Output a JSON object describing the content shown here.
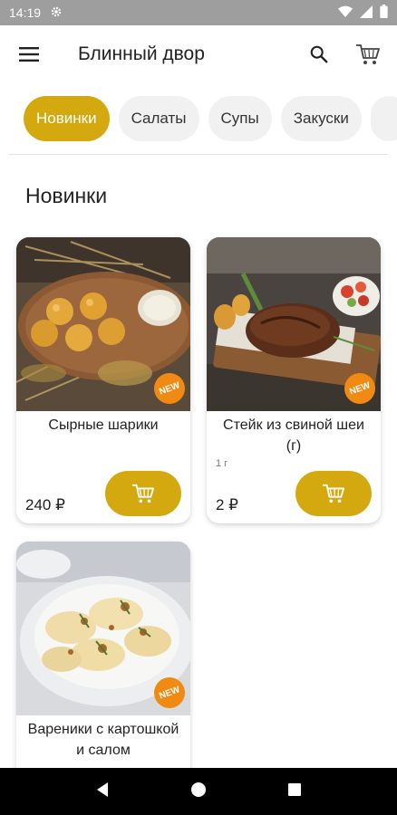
{
  "status_bar": {
    "time": "14:19"
  },
  "app_bar": {
    "title": "Блинный двор"
  },
  "categories": [
    {
      "label": "Новинки",
      "active": true
    },
    {
      "label": "Салаты",
      "active": false
    },
    {
      "label": "Супы",
      "active": false
    },
    {
      "label": "Закуски",
      "active": false
    }
  ],
  "section": {
    "title": "Новинки"
  },
  "products": [
    {
      "name": "Сырные шарики",
      "weight": "",
      "price": "240 ₽",
      "badge": "NEW"
    },
    {
      "name": "Стейк из свиной шеи (г)",
      "weight": "1 г",
      "price": "2 ₽",
      "badge": "NEW"
    },
    {
      "name": "Вареники с картошкой и салом",
      "weight": "",
      "price": "",
      "badge": "NEW"
    }
  ],
  "colors": {
    "accent": "#d4a90f",
    "badge": "#f18a12",
    "status_bar": "#9e9e9e",
    "nav_bar": "#000000"
  },
  "icons": [
    "settings-icon",
    "wifi-icon",
    "signal-icon",
    "battery-icon",
    "menu-icon",
    "search-icon",
    "cart-icon",
    "back-icon",
    "home-icon",
    "recents-icon"
  ]
}
